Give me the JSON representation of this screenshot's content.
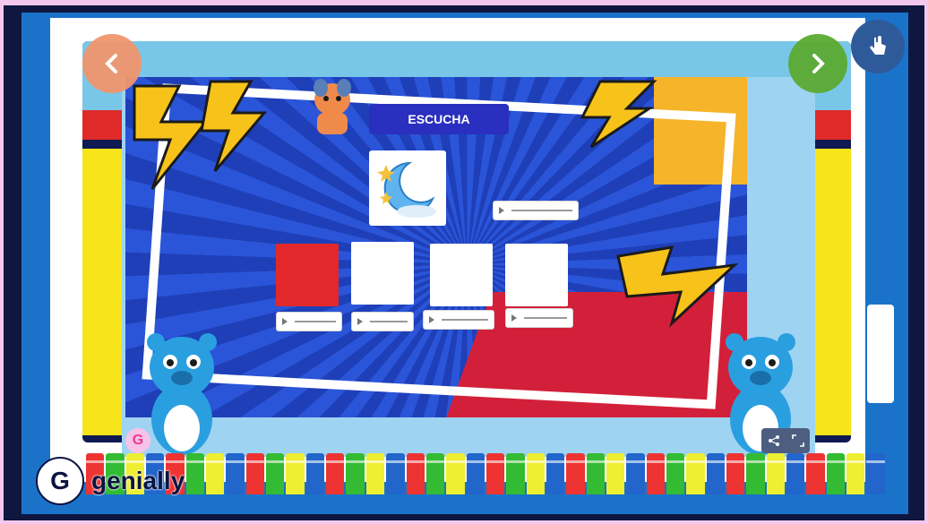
{
  "slide": {
    "title": "ESCUCHA"
  },
  "brand": {
    "name": "genially",
    "badge_letter": "G"
  },
  "colors": {
    "frame": "#0f1740",
    "panel": "#1a73c9",
    "title_bg": "#2a2fbf",
    "choice_red": "#e3282c",
    "nav_prev": "#f0966e",
    "nav_next": "#5caa32"
  },
  "icons": {
    "prev": "chevron-left-icon",
    "next": "chevron-right-icon",
    "unlock": "hand-pointer-icon",
    "share": "share-icon",
    "fullscreen": "expand-icon",
    "moon": "moon-stars-icon"
  },
  "choices": [
    {
      "color": "red"
    },
    {
      "color": "white"
    },
    {
      "color": "white"
    },
    {
      "color": "white"
    }
  ],
  "crayon_colors": [
    "#e33",
    "#3b3",
    "#ee3",
    "#26c"
  ]
}
